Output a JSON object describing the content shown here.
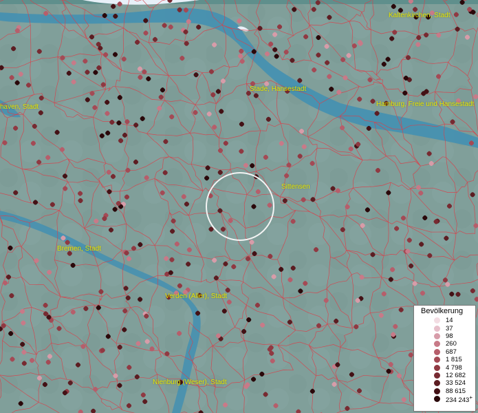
{
  "map": {
    "places": [
      {
        "id": "kaltenkirchen",
        "label": "Kaltenkirchen, Stadt"
      },
      {
        "id": "stade",
        "label": "Stade, Hansestadt"
      },
      {
        "id": "hamburg",
        "label": "Hamburg, Freie und Hansestadt"
      },
      {
        "id": "bremerhaven",
        "label": "haven, Stadt"
      },
      {
        "id": "sittensen",
        "label": "Sittensen"
      },
      {
        "id": "bremen",
        "label": "Bremen, Stadt"
      },
      {
        "id": "verden",
        "label": "Verden (Aller), Stadt"
      },
      {
        "id": "nienburg",
        "label": "Nienburg (Weser), Stadt"
      }
    ]
  },
  "legend": {
    "title": "Bevölkerung",
    "classes": [
      {
        "value": "14",
        "color": "#f3dde3"
      },
      {
        "value": "37",
        "color": "#e7bfca"
      },
      {
        "value": "98",
        "color": "#d79ca9"
      },
      {
        "value": "260",
        "color": "#c87a88"
      },
      {
        "value": "687",
        "color": "#b65e6b"
      },
      {
        "value": "1 815",
        "color": "#a44a55"
      },
      {
        "value": "4 798",
        "color": "#903942"
      },
      {
        "value": "12 682",
        "color": "#772a31"
      },
      {
        "value": "33 524",
        "color": "#5c1d22"
      },
      {
        "value": "88 615",
        "color": "#431115"
      },
      {
        "value": "234 243",
        "color": "#2a080a",
        "suffix": "+"
      }
    ]
  }
}
